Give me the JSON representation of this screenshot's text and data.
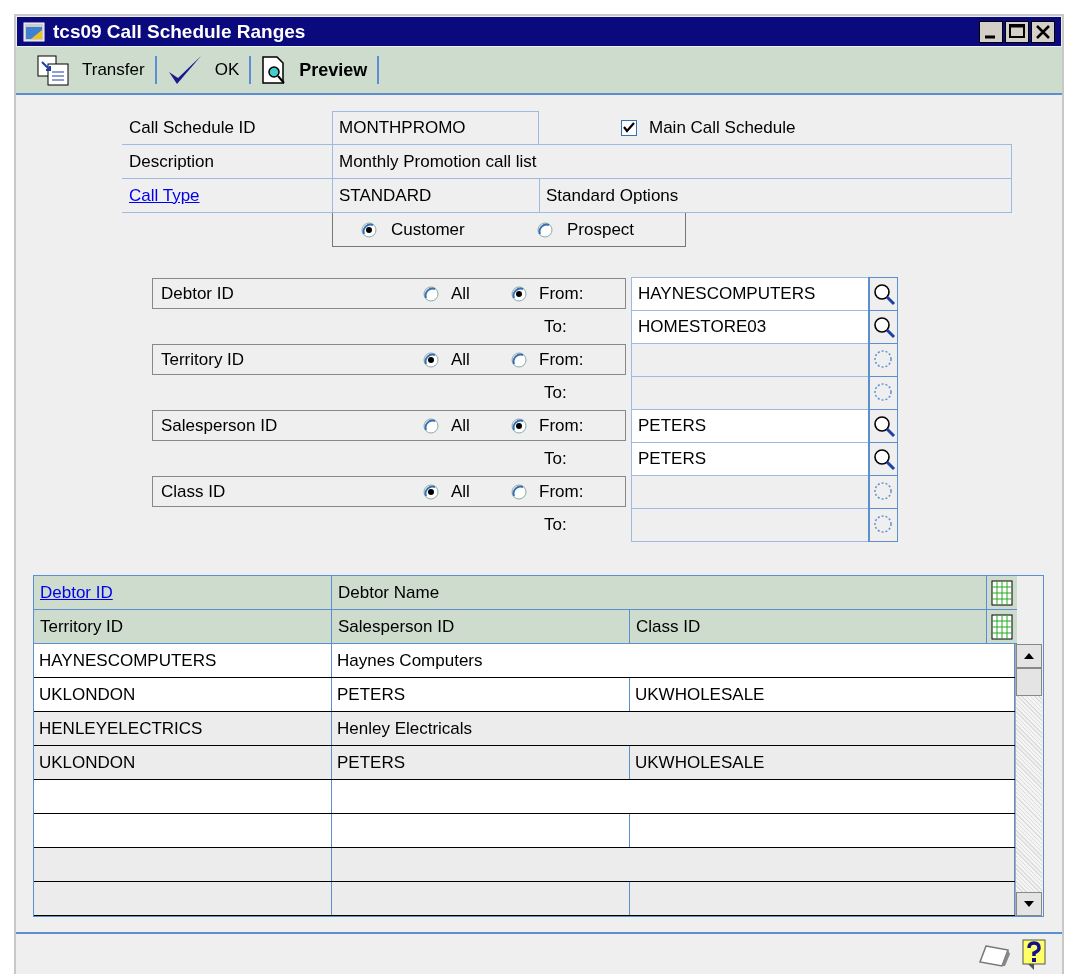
{
  "window": {
    "title": "tcs09 Call Schedule Ranges"
  },
  "toolbar": [
    {
      "label": "Transfer",
      "kind": "transfer"
    },
    {
      "label": "OK",
      "kind": "ok"
    },
    {
      "label": "Preview",
      "kind": "preview"
    }
  ],
  "header": {
    "call_schedule_id": {
      "label": "Call Schedule ID",
      "value": "MONTHPROMO"
    },
    "main_call_schedule": {
      "label": "Main Call Schedule",
      "checked": true
    },
    "description": {
      "label": "Description",
      "value": "Monthly Promotion call list"
    },
    "call_type": {
      "label": "Call Type",
      "value": "STANDARD",
      "option": "Standard Options"
    },
    "party": [
      {
        "label": "Customer",
        "selected": true
      },
      {
        "label": "Prospect",
        "selected": false
      }
    ]
  },
  "ranges": [
    {
      "label": "Debtor ID",
      "all": {
        "label": "All",
        "selected": false
      },
      "from": {
        "label": "From:",
        "selected": true
      },
      "from_field": {
        "value": "HAYNESCOMPUTERS",
        "disabled": false
      },
      "to_label": "To:",
      "to_field": {
        "value": "HOMESTORE03",
        "disabled": false
      }
    },
    {
      "label": "Territory ID",
      "all": {
        "label": "All",
        "selected": true
      },
      "from": {
        "label": "From:",
        "selected": false
      },
      "from_field": {
        "disabled": true
      },
      "to_label": "To:",
      "to_field": {
        "disabled": true
      }
    },
    {
      "label": "Salesperson ID",
      "all": {
        "label": "All",
        "selected": false
      },
      "from": {
        "label": "From:",
        "selected": true
      },
      "from_field": {
        "value": "PETERS",
        "disabled": false
      },
      "to_label": "To:",
      "to_field": {
        "value": "PETERS",
        "disabled": false
      }
    },
    {
      "label": "Class ID",
      "all": {
        "label": "All",
        "selected": true
      },
      "from": {
        "label": "From:",
        "selected": false
      },
      "from_field": {
        "disabled": true
      },
      "to_label": "To:",
      "to_field": {
        "disabled": true
      }
    }
  ],
  "grid": {
    "columns_1": [
      {
        "label": "Debtor ID",
        "link": true
      },
      {
        "label": "Debtor Name",
        "link": false
      }
    ],
    "columns_2": [
      {
        "label": "Territory ID"
      },
      {
        "label": "Salesperson ID"
      },
      {
        "label": "Class ID"
      }
    ],
    "records": [
      {
        "debtor_id": "HAYNESCOMPUTERS",
        "debtor_name": "Haynes Computers",
        "territory_id": "UKLONDON",
        "salesperson_id": "PETERS",
        "class_id": "UKWHOLESALE"
      },
      {
        "debtor_id": "HENLEYELECTRICS",
        "debtor_name": "Henley Electricals",
        "territory_id": "UKLONDON",
        "salesperson_id": "PETERS",
        "class_id": "UKWHOLESALE"
      }
    ]
  }
}
